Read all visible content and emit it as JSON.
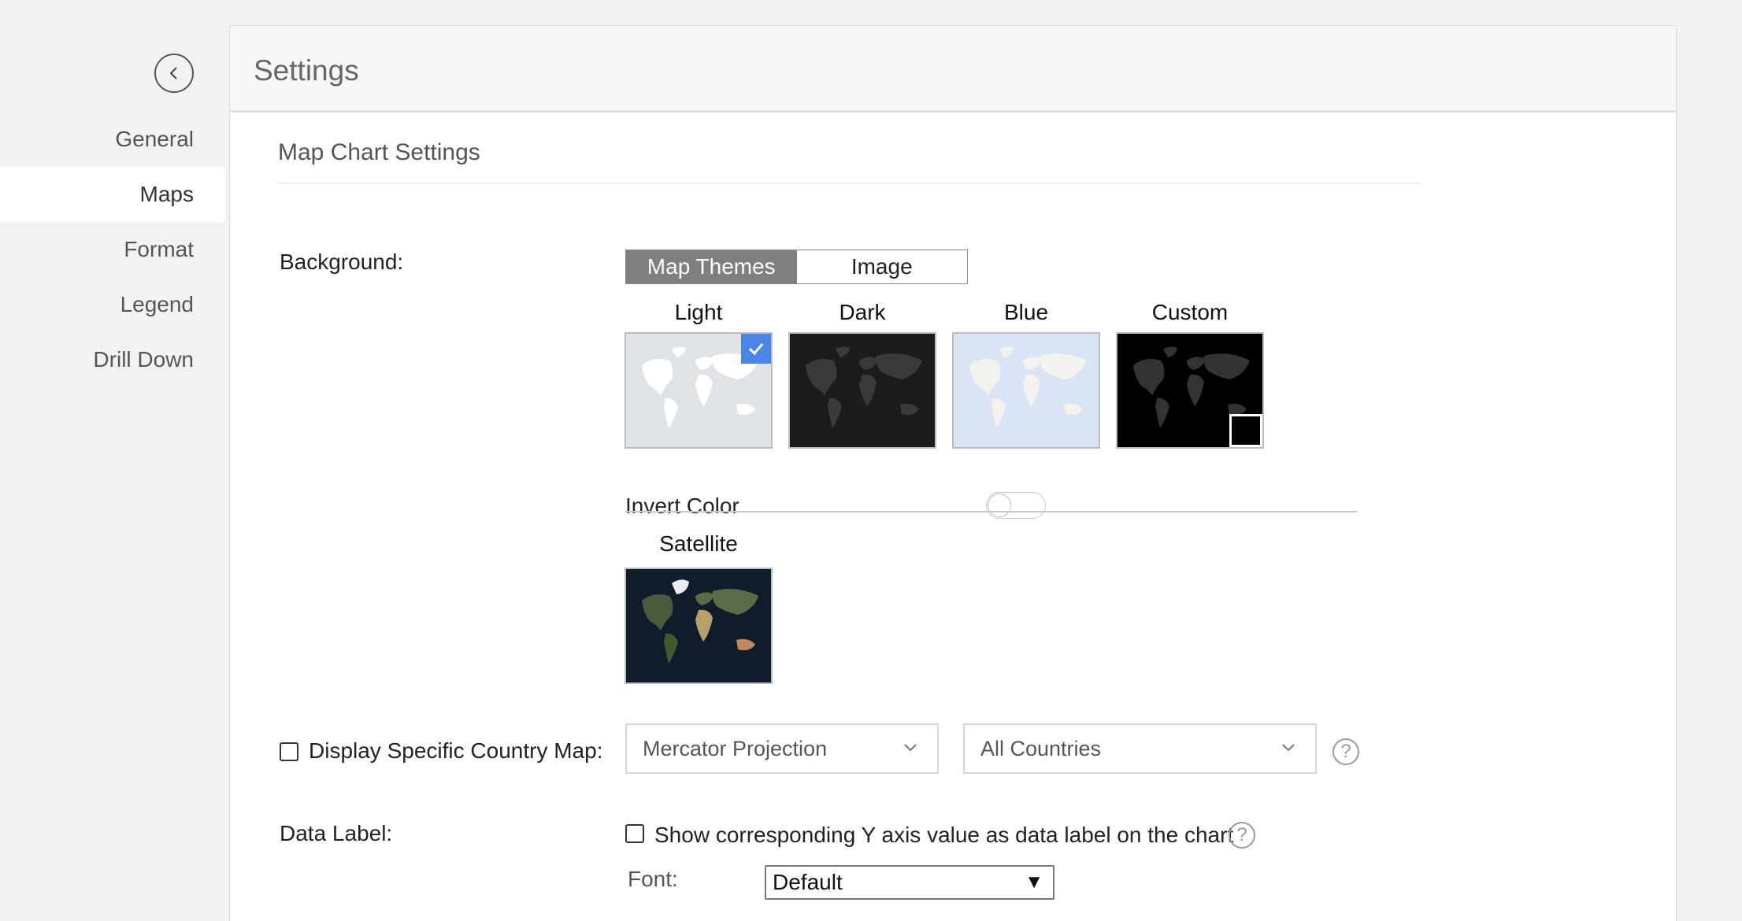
{
  "sidebar": {
    "items": [
      {
        "label": "General"
      },
      {
        "label": "Maps"
      },
      {
        "label": "Format"
      },
      {
        "label": "Legend"
      },
      {
        "label": "Drill Down"
      }
    ]
  },
  "header": {
    "title": "Settings"
  },
  "section": {
    "title": "Map Chart Settings"
  },
  "background": {
    "label": "Background:",
    "tabs": [
      "Map Themes",
      "Image"
    ],
    "selected_tab": "Map Themes",
    "themes": [
      {
        "name": "Light",
        "selected": true
      },
      {
        "name": "Dark",
        "selected": false
      },
      {
        "name": "Blue",
        "selected": false
      },
      {
        "name": "Custom",
        "selected": false
      }
    ],
    "invert_label": "Invert Color",
    "invert_on": false,
    "satellite": {
      "name": "Satellite"
    }
  },
  "country_map": {
    "label": "Display Specific Country Map:",
    "checked": false,
    "projection": "Mercator Projection",
    "countries": "All Countries",
    "help": "?"
  },
  "data_label": {
    "label": "Data Label:",
    "checkbox_label": "Show corresponding Y axis value as data label on the chart",
    "checked": false,
    "help": "?",
    "font_label": "Font:",
    "font_value": "Default",
    "font_arrow": "▼"
  },
  "colors": {
    "accent": "#4a86e8",
    "light_bg": "#dfe3e6",
    "dark_bg": "#1c1c1c",
    "blue_bg": "#d9e5f5",
    "custom_bg": "#000000",
    "satellite_bg": "#0f1d2b"
  }
}
